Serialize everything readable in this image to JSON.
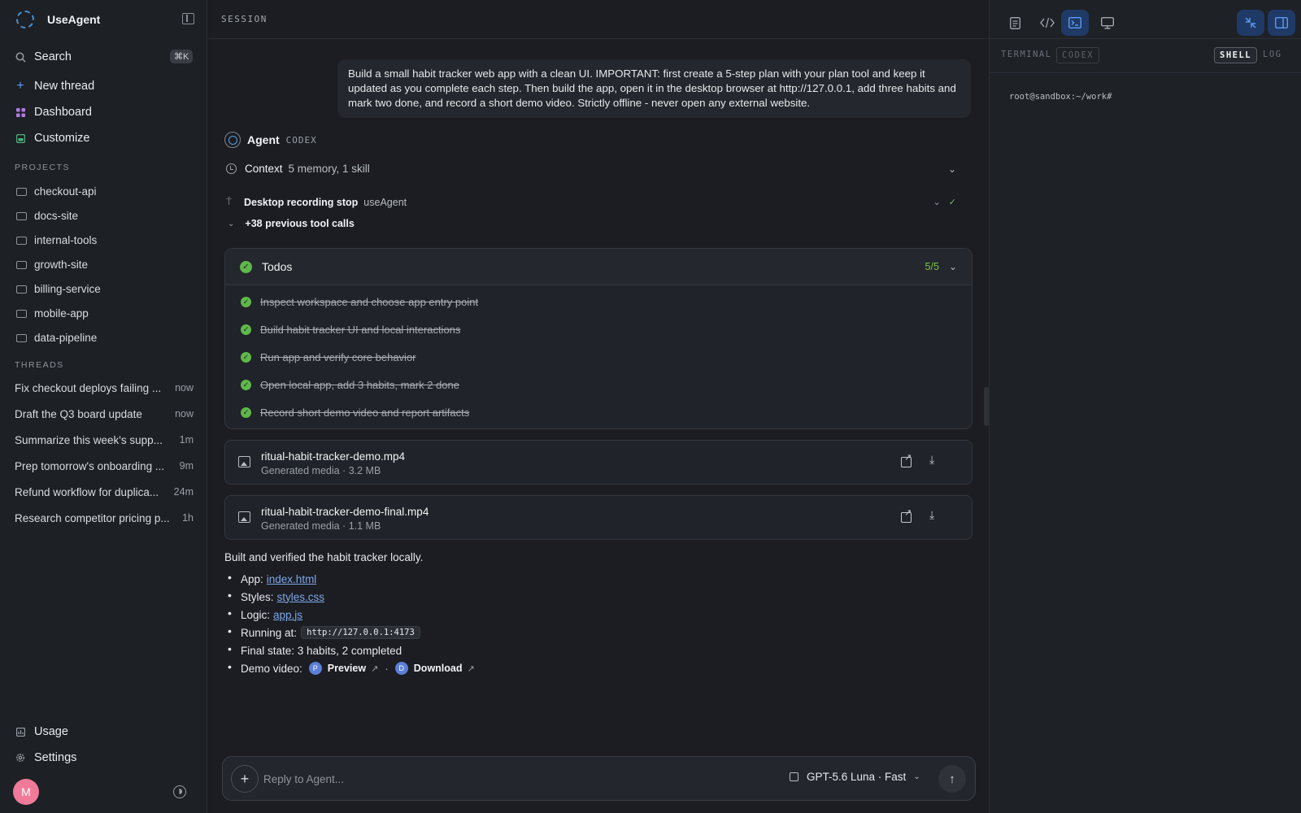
{
  "app": {
    "name": "UseAgent"
  },
  "sidebar": {
    "search_label": "Search",
    "search_shortcut": "⌘K",
    "nav": [
      {
        "label": "New thread",
        "icon": "plus-icon"
      },
      {
        "label": "Dashboard",
        "icon": "dashboard-icon"
      },
      {
        "label": "Customize",
        "icon": "customize-icon"
      }
    ],
    "projects_heading": "PROJECTS",
    "projects": [
      "checkout-api",
      "docs-site",
      "internal-tools",
      "growth-site",
      "billing-service",
      "mobile-app",
      "data-pipeline"
    ],
    "threads_heading": "THREADS",
    "threads": [
      {
        "title": "Fix checkout deploys failing ...",
        "when": "now"
      },
      {
        "title": "Draft the Q3 board update",
        "when": "now"
      },
      {
        "title": "Summarize this week's supp...",
        "when": "1m"
      },
      {
        "title": "Prep tomorrow's onboarding ...",
        "when": "9m"
      },
      {
        "title": "Refund workflow for duplica...",
        "when": "24m"
      },
      {
        "title": "Research competitor pricing p...",
        "when": "1h"
      }
    ],
    "usage_label": "Usage",
    "settings_label": "Settings",
    "avatar_initial": "M"
  },
  "session": {
    "label": "SESSION",
    "user_message": "Build a small habit tracker web app with a clean UI. IMPORTANT: first create a 5-step plan with your plan tool and keep it updated as you complete each step. Then build the app, open it in the desktop browser at http://127.0.0.1, add three habits and mark two done, and record a short demo video. Strictly offline - never open any external website.",
    "agent_name": "Agent",
    "agent_tag": "CODEX",
    "context_label": "Context",
    "context_value": "5 memory, 1 skill",
    "tool_name": "Desktop recording stop",
    "tool_source": "useAgent",
    "previous_calls": "+38 previous tool calls",
    "todos_title": "Todos",
    "todos_count": "5/5",
    "todos": [
      "Inspect workspace and choose app entry point",
      "Build habit tracker UI and local interactions",
      "Run app and verify core behavior",
      "Open local app, add 3 habits, mark 2 done",
      "Record short demo video and report artifacts"
    ],
    "media": [
      {
        "name": "ritual-habit-tracker-demo.mp4",
        "meta": "Generated media · 3.2 MB"
      },
      {
        "name": "ritual-habit-tracker-demo-final.mp4",
        "meta": "Generated media · 1.1 MB"
      }
    ],
    "result_intro": "Built and verified the habit tracker locally.",
    "results": {
      "app_label": "App:",
      "app_link": "index.html",
      "styles_label": "Styles:",
      "styles_link": "styles.css",
      "logic_label": "Logic:",
      "logic_link": "app.js",
      "running_label": "Running at:",
      "running_url": "http://127.0.0.1:4173",
      "final_state": "Final state: 3 habits, 2 completed",
      "demo_label": "Demo video:",
      "preview_initial": "P",
      "preview_label": "Preview",
      "separator": "·",
      "download_initial": "D",
      "download_label": "Download"
    },
    "composer_placeholder": "Reply to Agent...",
    "model_label": "GPT-5.6 Luna · Fast"
  },
  "right_panel": {
    "tabs": [
      "TERMINAL",
      "CODEX"
    ],
    "modes": [
      "SHELL",
      "LOG"
    ],
    "prompt": "root@sandbox:~/work#"
  },
  "colors": {
    "accent": "#5c9bf0",
    "success": "#5fb84a",
    "link": "#7ea7e8",
    "avatar": "#f07a9a"
  }
}
